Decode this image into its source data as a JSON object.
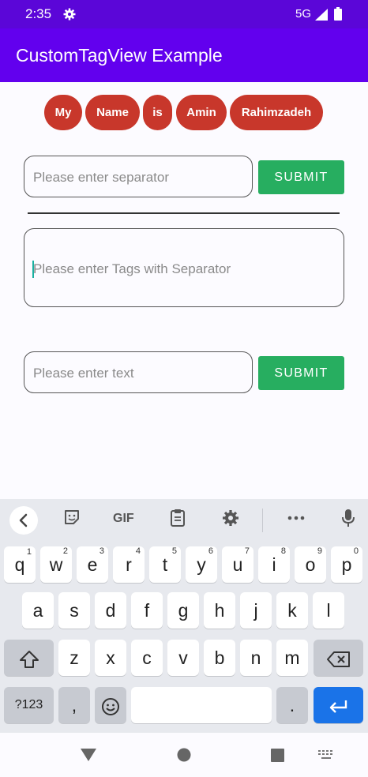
{
  "status": {
    "time": "2:35",
    "network": "5G"
  },
  "app": {
    "title": "CustomTagView Example"
  },
  "tags": [
    "My",
    "Name",
    "is",
    "Amin",
    "Rahimzadeh"
  ],
  "separator_input": {
    "placeholder": "Please enter separator",
    "submit_label": "SUBMIT"
  },
  "tags_input": {
    "placeholder": "Please enter Tags with Separator"
  },
  "text_input": {
    "placeholder": "Please enter text",
    "submit_label": "SUBMIT"
  },
  "keyboard": {
    "toolbar": {
      "gif": "GIF"
    },
    "row1": [
      "q",
      "w",
      "e",
      "r",
      "t",
      "y",
      "u",
      "i",
      "o",
      "p"
    ],
    "row1_digits": [
      "1",
      "2",
      "3",
      "4",
      "5",
      "6",
      "7",
      "8",
      "9",
      "0"
    ],
    "row2": [
      "a",
      "s",
      "d",
      "f",
      "g",
      "h",
      "j",
      "k",
      "l"
    ],
    "row3": [
      "z",
      "x",
      "c",
      "v",
      "b",
      "n",
      "m"
    ],
    "symbols_key": "?123",
    "comma_key": ",",
    "period_key": "."
  },
  "colors": {
    "status_bar": "#5b06d8",
    "app_bar": "#6200ee",
    "tag": "#c8372b",
    "button": "#27ae60",
    "enter_key": "#1a73e8"
  }
}
